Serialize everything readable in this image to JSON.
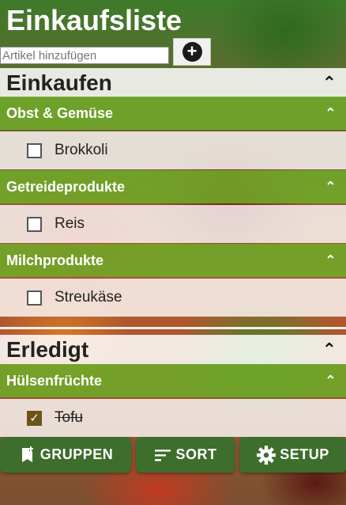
{
  "app": {
    "title": "Einkaufsliste"
  },
  "add": {
    "placeholder": "Artikel hinzufügen",
    "button_icon": "plus-circle-icon"
  },
  "sections": {
    "shopping": {
      "title": "Einkaufen",
      "groups": [
        {
          "name": "Obst & Gemüse",
          "items": [
            {
              "label": "Brokkoli",
              "checked": false
            }
          ]
        },
        {
          "name": "Getreideprodukte",
          "items": [
            {
              "label": "Reis",
              "checked": false
            }
          ]
        },
        {
          "name": "Milchprodukte",
          "items": [
            {
              "label": "Streukäse",
              "checked": false
            }
          ]
        }
      ]
    },
    "done": {
      "title": "Erledigt",
      "groups": [
        {
          "name": "Hülsenfrüchte",
          "items": [
            {
              "label": "Tofu",
              "checked": true
            }
          ]
        }
      ]
    }
  },
  "toolbar": {
    "groups_label": "GRUPPEN",
    "sort_label": "SORT",
    "setup_label": "SETUP"
  },
  "colors": {
    "group_header": "#6eaa28",
    "toolbar_button": "#3d6e2c",
    "checked_box": "#6b5418"
  }
}
